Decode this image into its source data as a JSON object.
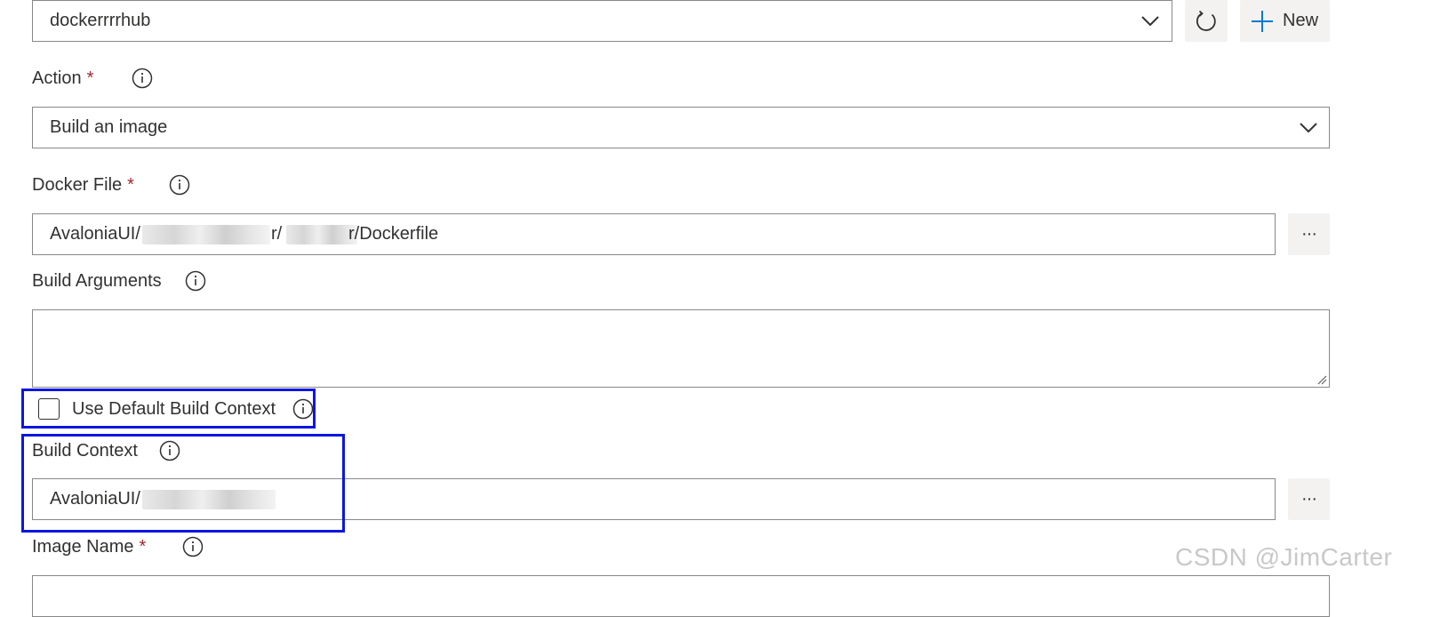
{
  "service_connection": {
    "value": "dockerrrrhub",
    "refresh_icon": "refresh-icon",
    "new_label": "New",
    "new_icon": "plus-icon"
  },
  "action": {
    "label": "Action",
    "required_mark": "*",
    "value": "Build an image"
  },
  "docker_file": {
    "label": "Docker File",
    "required_mark": "*",
    "value_prefix": "AvaloniaUI/",
    "value_mid1": "r/",
    "value_mid2": "r/Dockerfile",
    "browse_label": "···"
  },
  "build_arguments": {
    "label": "Build Arguments",
    "value": ""
  },
  "use_default_build_context": {
    "label": "Use Default Build Context",
    "checked": false
  },
  "build_context": {
    "label": "Build Context",
    "value_prefix": "AvaloniaUI/",
    "browse_label": "···"
  },
  "image_name": {
    "label": "Image Name",
    "required_mark": "*"
  },
  "watermark": "CSDN @JimCarter",
  "colors": {
    "highlight_border": "#0b16e0",
    "required": "#a4262c",
    "button_bg": "#f3f2f1",
    "accent": "#0078d4"
  }
}
